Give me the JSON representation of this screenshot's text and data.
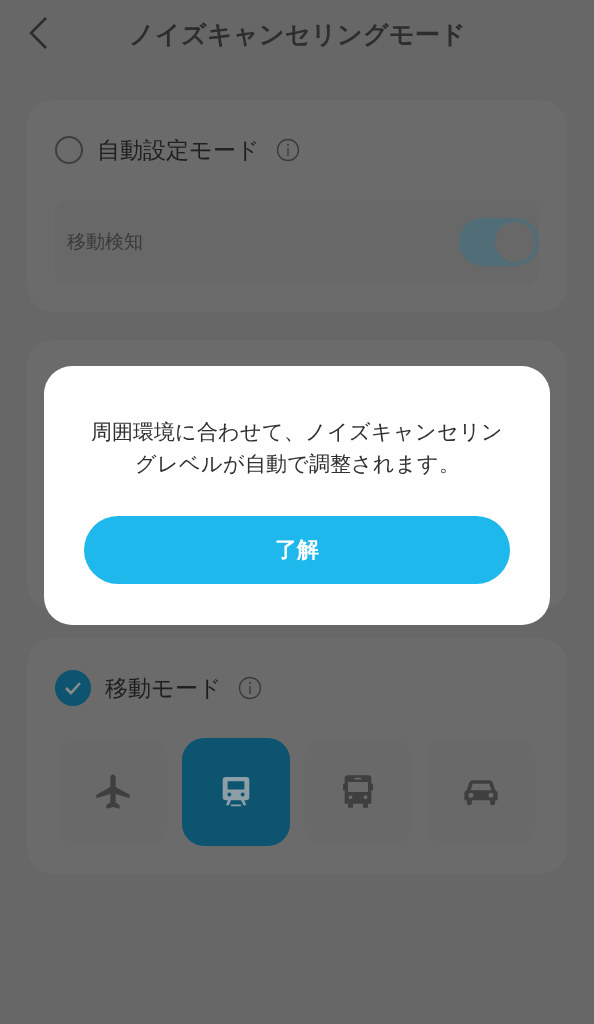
{
  "header": {
    "title": "ノイズキャンセリングモード"
  },
  "auto_mode": {
    "label": "自動設定モード",
    "selected": false,
    "motion_detection": {
      "label": "移動検知",
      "on": true
    }
  },
  "travel_mode": {
    "label": "移動モード",
    "checked": true,
    "modes": [
      {
        "kind": "plane",
        "selected": false
      },
      {
        "kind": "train",
        "selected": true
      },
      {
        "kind": "bus",
        "selected": false
      },
      {
        "kind": "car",
        "selected": false
      }
    ]
  },
  "dialog": {
    "message": "周囲環境に合わせて、ノイズキャンセリングレベルが自動で調整されます。",
    "button": "了解"
  }
}
